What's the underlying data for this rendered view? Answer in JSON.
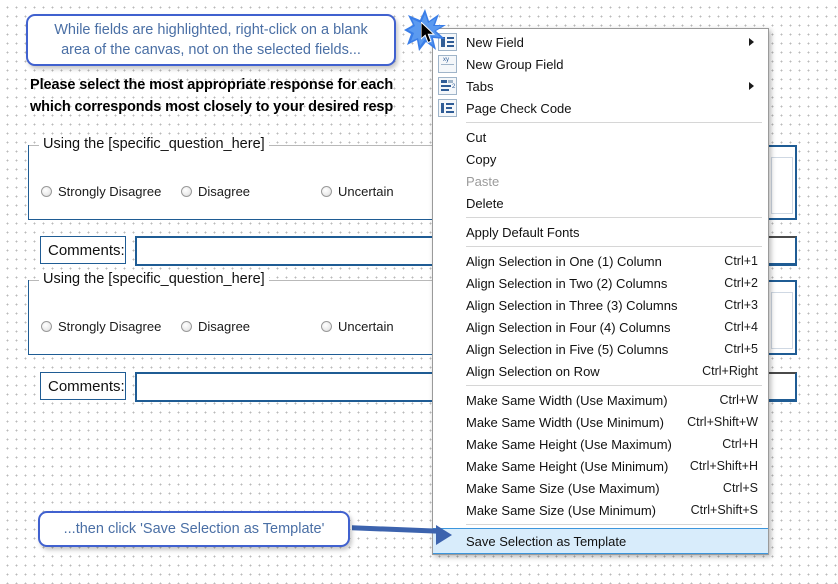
{
  "callouts": {
    "top": {
      "line1": "While fields are highlighted, right-click on a blank",
      "line2": "area of the canvas, not on the selected fields..."
    },
    "bottom": {
      "text": "...then click 'Save Selection as Template'"
    }
  },
  "form": {
    "heading_line1": "Please select the most appropriate response for each",
    "heading_line2": "which corresponds most closely to your desired resp",
    "groups": [
      {
        "legend": "Using the [specific_question_here]",
        "options": [
          "Strongly Disagree",
          "Disagree",
          "Uncertain"
        ]
      },
      {
        "legend": "Using the [specific_question_here]",
        "options": [
          "Strongly Disagree",
          "Disagree",
          "Uncertain"
        ]
      }
    ],
    "comments_label": "Comments:",
    "comments_value": ""
  },
  "context_menu": {
    "items": [
      {
        "label": "New Field",
        "accel": "",
        "icon": "new-field-icon",
        "submenu": true,
        "disabled": false,
        "selected": false
      },
      {
        "label": "New Group Field",
        "accel": "",
        "icon": "new-group-field-icon",
        "submenu": false,
        "disabled": false,
        "selected": false
      },
      {
        "label": "Tabs",
        "accel": "",
        "icon": "tabs-icon",
        "submenu": true,
        "disabled": false,
        "selected": false
      },
      {
        "label": "Page Check Code",
        "accel": "",
        "icon": "page-check-code-icon",
        "submenu": false,
        "disabled": false,
        "selected": false
      },
      {
        "separator": true
      },
      {
        "label": "Cut",
        "accel": "",
        "icon": "",
        "submenu": false,
        "disabled": false,
        "selected": false
      },
      {
        "label": "Copy",
        "accel": "",
        "icon": "",
        "submenu": false,
        "disabled": false,
        "selected": false
      },
      {
        "label": "Paste",
        "accel": "",
        "icon": "",
        "submenu": false,
        "disabled": true,
        "selected": false
      },
      {
        "label": "Delete",
        "accel": "",
        "icon": "",
        "submenu": false,
        "disabled": false,
        "selected": false
      },
      {
        "separator": true
      },
      {
        "label": "Apply Default Fonts",
        "accel": "",
        "icon": "",
        "submenu": false,
        "disabled": false,
        "selected": false
      },
      {
        "separator": true
      },
      {
        "label": "Align Selection in One (1) Column",
        "accel": "Ctrl+1",
        "icon": "",
        "submenu": false,
        "disabled": false,
        "selected": false
      },
      {
        "label": "Align Selection in Two (2) Columns",
        "accel": "Ctrl+2",
        "icon": "",
        "submenu": false,
        "disabled": false,
        "selected": false
      },
      {
        "label": "Align Selection in Three (3) Columns",
        "accel": "Ctrl+3",
        "icon": "",
        "submenu": false,
        "disabled": false,
        "selected": false
      },
      {
        "label": "Align Selection in Four (4) Columns",
        "accel": "Ctrl+4",
        "icon": "",
        "submenu": false,
        "disabled": false,
        "selected": false
      },
      {
        "label": "Align Selection in Five (5) Columns",
        "accel": "Ctrl+5",
        "icon": "",
        "submenu": false,
        "disabled": false,
        "selected": false
      },
      {
        "label": "Align Selection on Row",
        "accel": "Ctrl+Right",
        "icon": "",
        "submenu": false,
        "disabled": false,
        "selected": false
      },
      {
        "separator": true
      },
      {
        "label": "Make Same Width (Use Maximum)",
        "accel": "Ctrl+W",
        "icon": "",
        "submenu": false,
        "disabled": false,
        "selected": false
      },
      {
        "label": "Make Same Width (Use Minimum)",
        "accel": "Ctrl+Shift+W",
        "icon": "",
        "submenu": false,
        "disabled": false,
        "selected": false
      },
      {
        "label": "Make Same Height (Use Maximum)",
        "accel": "Ctrl+H",
        "icon": "",
        "submenu": false,
        "disabled": false,
        "selected": false
      },
      {
        "label": "Make Same Height (Use Minimum)",
        "accel": "Ctrl+Shift+H",
        "icon": "",
        "submenu": false,
        "disabled": false,
        "selected": false
      },
      {
        "label": "Make Same Size (Use Maximum)",
        "accel": "Ctrl+S",
        "icon": "",
        "submenu": false,
        "disabled": false,
        "selected": false
      },
      {
        "label": "Make Same Size (Use Minimum)",
        "accel": "Ctrl+Shift+S",
        "icon": "",
        "submenu": false,
        "disabled": false,
        "selected": false
      },
      {
        "separator": true
      },
      {
        "label": "Save Selection as Template",
        "accel": "",
        "icon": "",
        "submenu": false,
        "disabled": false,
        "selected": true
      }
    ]
  },
  "colors": {
    "callout_border": "#4061cf",
    "callout_text": "#4a6fa5",
    "arrow": "#3c63ae",
    "field_border": "#1f5c94",
    "menu_highlight_bg": "#d8ecfb",
    "menu_highlight_border": "#3c96dd",
    "starburst": "#3a7ee8"
  }
}
